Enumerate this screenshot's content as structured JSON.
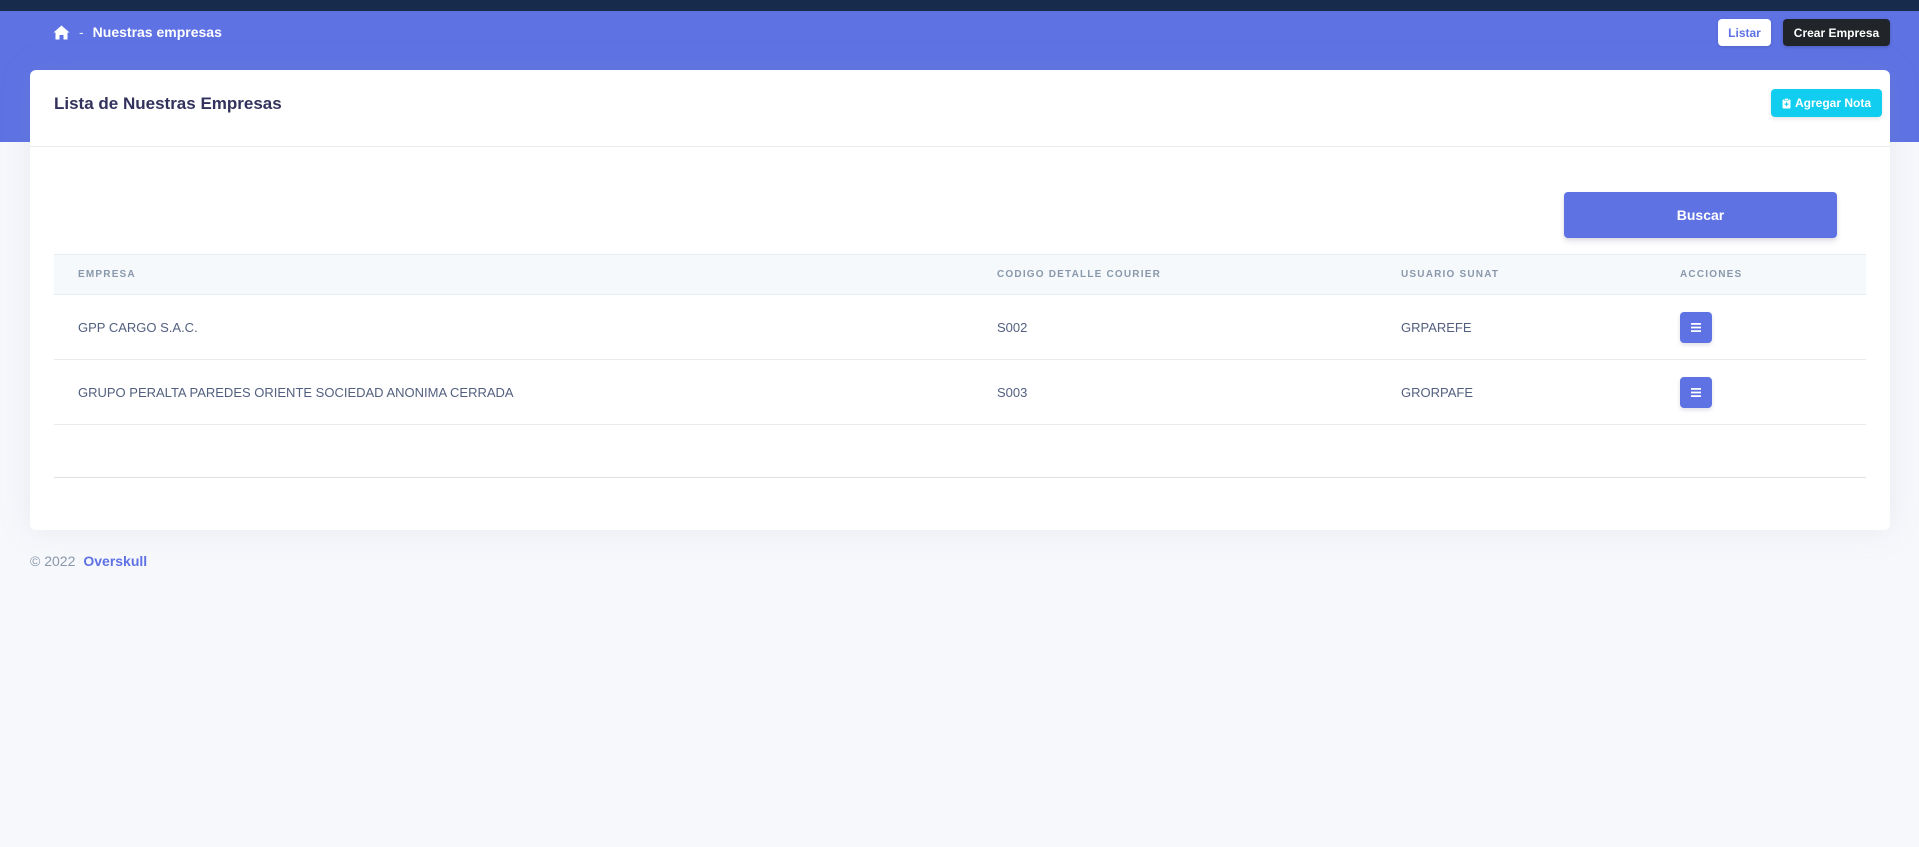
{
  "breadcrumb": {
    "home_icon": "home-icon",
    "separator": "-",
    "current": "Nuestras empresas"
  },
  "header_actions": {
    "listar_label": "Listar",
    "crear_label": "Crear Empresa"
  },
  "card": {
    "title": "Lista de Nuestras Empresas",
    "nota_label": "Agregar Nota",
    "nota_icon": "clipboard-plus-icon",
    "buscar_label": "Buscar"
  },
  "table": {
    "headers": [
      "EMPRESA",
      "CODIGO DETALLE COURIER",
      "USUARIO SUNAT",
      "ACCIONES"
    ],
    "rows": [
      {
        "empresa": "GPP CARGO S.A.C.",
        "codigo": "S002",
        "usuario": "GRPAREFE",
        "action_icon": "bars-icon"
      },
      {
        "empresa": "GRUPO PERALTA PAREDES ORIENTE SOCIEDAD ANONIMA CERRADA",
        "codigo": "S003",
        "usuario": "GRORPAFE",
        "action_icon": "bars-icon"
      }
    ]
  },
  "footer": {
    "copyright": "© 2022",
    "brand": "Overskull"
  },
  "colors": {
    "primary": "#5e72e4",
    "dark": "#212529",
    "info": "#11cdef",
    "topbar": "#172b4d"
  }
}
